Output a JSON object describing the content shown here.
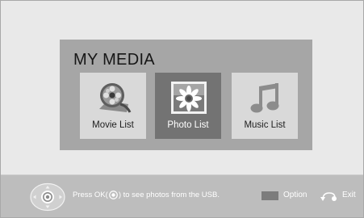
{
  "title": "MY MEDIA",
  "tiles": [
    {
      "label": "Movie List",
      "icon": "film-reel-icon",
      "selected": false
    },
    {
      "label": "Photo List",
      "icon": "flower-photo-icon",
      "selected": true
    },
    {
      "label": "Music List",
      "icon": "music-note-icon",
      "selected": false
    }
  ],
  "hint": {
    "before": "Press OK(",
    "after": ") to see photos from the USB."
  },
  "footer": {
    "option_label": "Option",
    "exit_label": "Exit"
  },
  "colors": {
    "background": "#e9e9e9",
    "panel": "#a6a6a6",
    "tile": "#d9d9d9",
    "tile_selected": "#737373",
    "bottom_bar": "#bdbdbd"
  }
}
